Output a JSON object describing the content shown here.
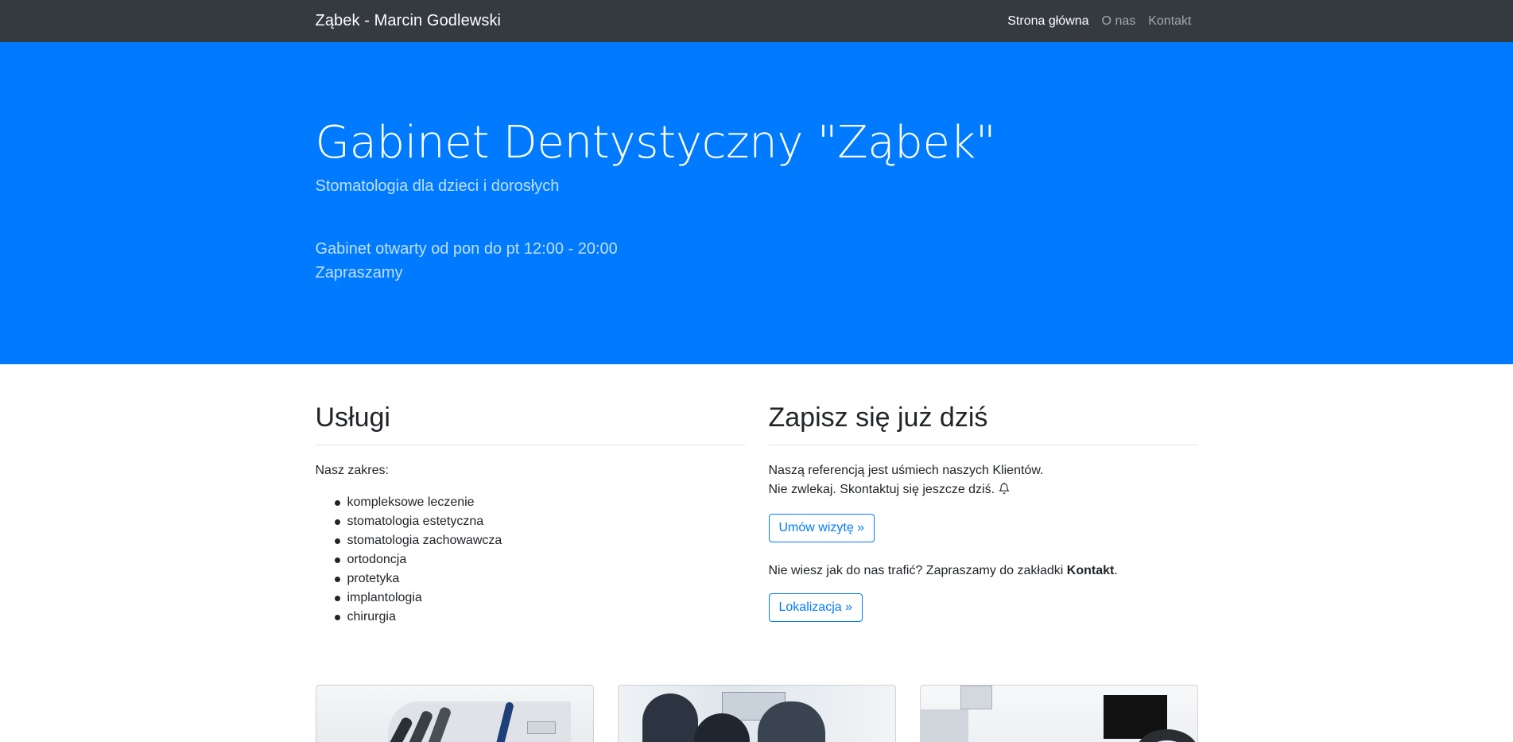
{
  "navbar": {
    "brand": "Ząbek - Marcin Godlewski",
    "links": [
      "Strona główna",
      "O nas",
      "Kontakt"
    ]
  },
  "hero": {
    "title": "Gabinet Dentystyczny \"Ząbek\"",
    "lead": "Stomatologia dla dzieci i dorosłych",
    "hours": "Gabinet otwarty od pon do pt 12:00 - 20:00",
    "invite": "Zapraszamy"
  },
  "services": {
    "heading": "Usługi",
    "intro": "Nasz zakres:",
    "items": [
      "kompleksowe leczenie",
      "stomatologia estetyczna",
      "stomatologia zachowawcza",
      "ortodoncja",
      "protetyka",
      "implantologia",
      "chirurgia"
    ]
  },
  "signup": {
    "heading": "Zapisz się już dziś",
    "line1": "Naszą referencją jest uśmiech naszych Klientów.",
    "line2": "Nie zwlekaj. Skontaktuj się jeszcze dziś.",
    "appointment_button": "Umów wizytę »",
    "location_text": "Nie wiesz jak do nas trafić? Zapraszamy do zakładki ",
    "location_bold": "Kontakt",
    "location_dot": ".",
    "location_button": "Lokalizacja »"
  },
  "icons": {
    "bell": "bell-icon"
  },
  "colors": {
    "navbar_bg": "#343a40",
    "hero_bg": "#007bff",
    "primary": "#007bff"
  }
}
